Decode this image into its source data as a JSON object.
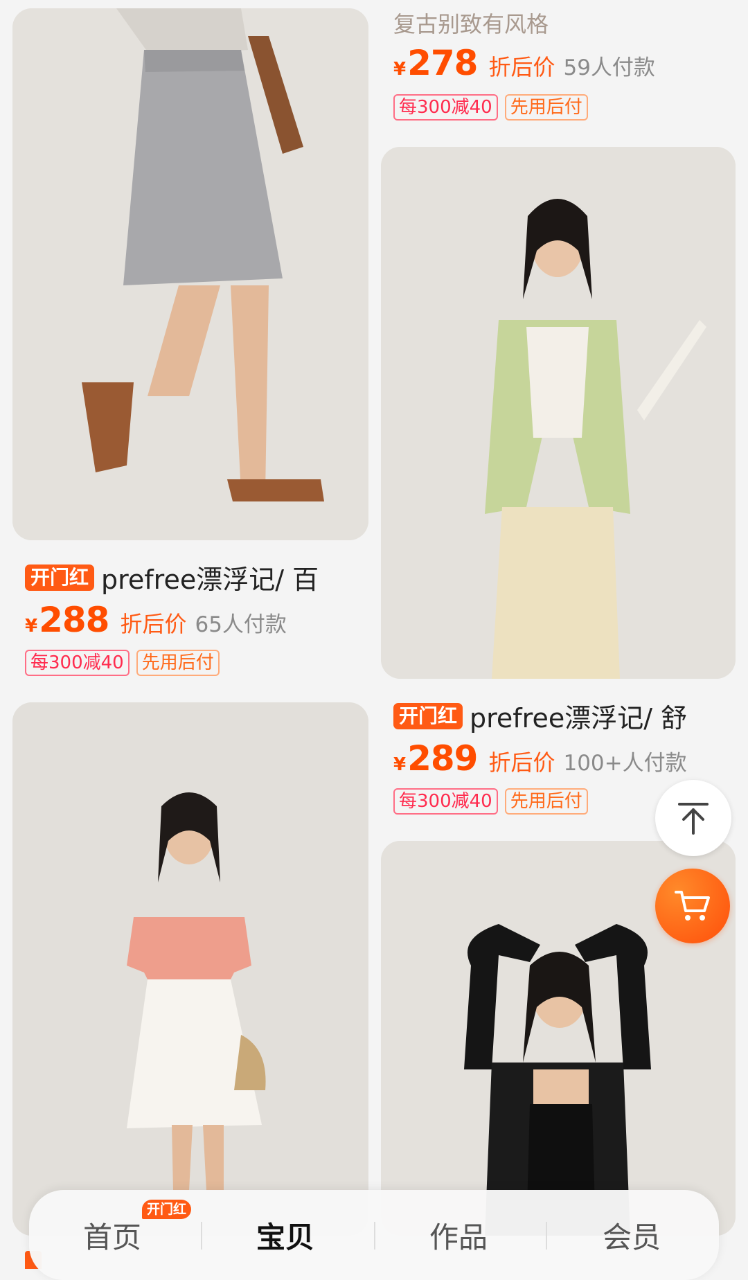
{
  "products": [
    {
      "id": "top-right-partial",
      "subtitle": "复古别致有风格",
      "yen": "¥",
      "price": "278",
      "price_label": "折后价",
      "sales": "59人付款",
      "badges": [
        "每300减40",
        "先用后付"
      ]
    },
    {
      "id": "left-1",
      "tag": "开门红",
      "title": "prefree漂浮记/ 百",
      "yen": "¥",
      "price": "288",
      "price_label": "折后价",
      "sales": "65人付款",
      "badges": [
        "每300减40",
        "先用后付"
      ]
    },
    {
      "id": "right-1",
      "tag": "开门红",
      "title": "prefree漂浮记/ 舒",
      "yen": "¥",
      "price": "289",
      "price_label": "折后价",
      "sales": "100+人付款",
      "badges": [
        "每300减40",
        "先用后付"
      ]
    }
  ],
  "icons": {
    "back_top": "arrow-up-to-top-icon",
    "cart": "shopping-cart-icon"
  },
  "tabbar": {
    "tabs": [
      {
        "label": "首页",
        "badge": "开门红"
      },
      {
        "label": "宝贝",
        "active": true
      },
      {
        "label": "作品"
      },
      {
        "label": "会员"
      }
    ]
  },
  "colors": {
    "accent": "#ff4d00",
    "tag_bg": "#ff5a14",
    "badge_red": "#ff2b4e",
    "badge_orange": "#ff6a1a"
  }
}
